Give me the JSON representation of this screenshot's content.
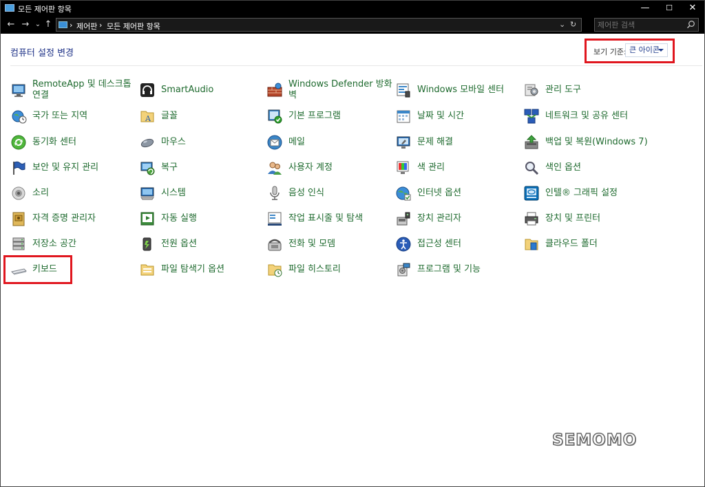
{
  "window": {
    "title": "모든 제어판 항목",
    "minimize": "—",
    "maximize": "☐",
    "close": "✕"
  },
  "nav": {
    "back": "←",
    "forward": "→",
    "recent": "⌄",
    "up": "↑",
    "breadcrumb": [
      "제어판",
      "모든 제어판 항목"
    ],
    "separator": "›",
    "dropdown": "⌄",
    "refresh": "↻"
  },
  "search": {
    "placeholder": "제어판 검색"
  },
  "header": {
    "title": "컴퓨터 설정 변경",
    "viewby_label": "보기 기준:",
    "viewby_value": "큰 아이콘"
  },
  "columns": [
    [
      {
        "label": "RemoteApp 및 데스크톱\n연결",
        "icon": "remote-desktop-icon"
      },
      {
        "label": "국가 또는 지역",
        "icon": "globe-clock-icon"
      },
      {
        "label": "동기화 센터",
        "icon": "sync-icon"
      },
      {
        "label": "보안 및 유지 관리",
        "icon": "flag-icon"
      },
      {
        "label": "소리",
        "icon": "speaker-icon"
      },
      {
        "label": "자격 증명 관리자",
        "icon": "vault-icon"
      },
      {
        "label": "저장소 공간",
        "icon": "storage-icon"
      },
      {
        "label": "키보드",
        "icon": "keyboard-icon"
      }
    ],
    [
      {
        "label": "SmartAudio",
        "icon": "headphones-icon"
      },
      {
        "label": "글꼴",
        "icon": "font-folder-icon"
      },
      {
        "label": "마우스",
        "icon": "mouse-icon"
      },
      {
        "label": "복구",
        "icon": "recovery-icon"
      },
      {
        "label": "시스템",
        "icon": "system-icon"
      },
      {
        "label": "자동 실행",
        "icon": "autoplay-icon"
      },
      {
        "label": "전원 옵션",
        "icon": "power-icon"
      },
      {
        "label": "파일 탐색기 옵션",
        "icon": "folder-options-icon"
      }
    ],
    [
      {
        "label": "Windows Defender 방화\n벽",
        "icon": "firewall-icon"
      },
      {
        "label": "기본 프로그램",
        "icon": "default-programs-icon"
      },
      {
        "label": "메일",
        "icon": "mail-icon"
      },
      {
        "label": "사용자 계정",
        "icon": "users-icon"
      },
      {
        "label": "음성 인식",
        "icon": "microphone-icon"
      },
      {
        "label": "작업 표시줄 및 탐색",
        "icon": "taskbar-icon"
      },
      {
        "label": "전화 및 모뎀",
        "icon": "phone-icon"
      },
      {
        "label": "파일 히스토리",
        "icon": "file-history-icon"
      }
    ],
    [
      {
        "label": "Windows 모바일 센터",
        "icon": "mobility-icon"
      },
      {
        "label": "날짜 및 시간",
        "icon": "calendar-icon"
      },
      {
        "label": "문제 해결",
        "icon": "troubleshoot-icon"
      },
      {
        "label": "색 관리",
        "icon": "color-icon"
      },
      {
        "label": "인터넷 옵션",
        "icon": "internet-icon"
      },
      {
        "label": "장치 관리자",
        "icon": "device-manager-icon"
      },
      {
        "label": "접근성 센터",
        "icon": "accessibility-icon"
      },
      {
        "label": "프로그램 및 기능",
        "icon": "programs-icon"
      }
    ],
    [
      {
        "label": "관리 도구",
        "icon": "admin-tools-icon"
      },
      {
        "label": "네트워크 및 공유 센터",
        "icon": "network-icon"
      },
      {
        "label": "백업 및 복원(Windows 7)",
        "icon": "backup-icon"
      },
      {
        "label": "색인 옵션",
        "icon": "indexing-icon"
      },
      {
        "label": "인텔® 그래픽 설정",
        "icon": "intel-graphics-icon"
      },
      {
        "label": "장치 및 프린터",
        "icon": "printer-icon"
      },
      {
        "label": "클라우드 폴더",
        "icon": "cloud-folder-icon"
      }
    ]
  ],
  "watermark": "SEMOMO"
}
